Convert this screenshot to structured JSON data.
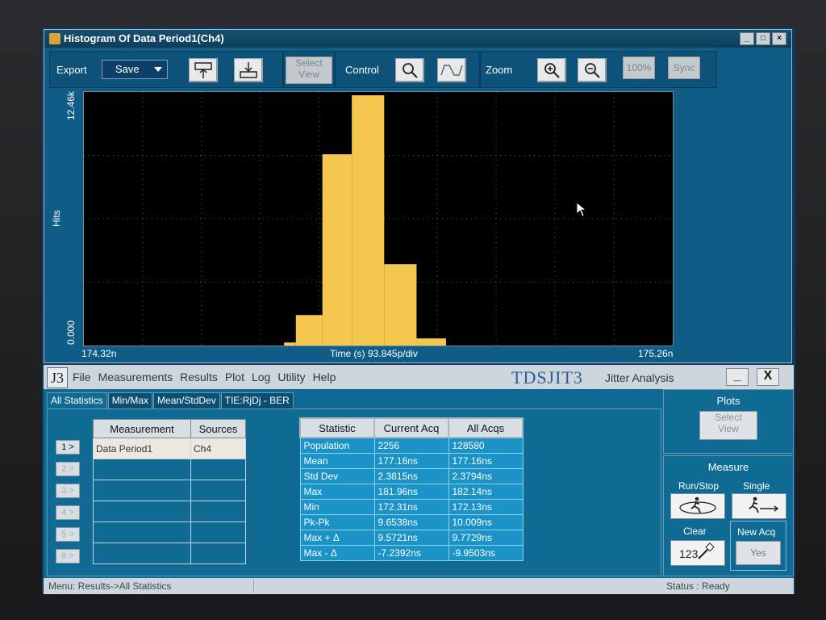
{
  "histogram_window": {
    "title": "Histogram Of Data Period1(Ch4)",
    "toolbar": {
      "export_label": "Export",
      "save_label": "Save",
      "select_view_label_1": "Select",
      "select_view_label_2": "View",
      "control_label": "Control",
      "zoom_label": "Zoom",
      "zoom_100_label": "100%",
      "sync_label": "Sync"
    },
    "plot": {
      "y_top": "12.46k",
      "y_bottom": "0.000",
      "y_label": "Hits",
      "x_left": "174.32n",
      "x_center": "Time (s)  93.845p/div",
      "x_right": "175.26n"
    }
  },
  "chart_data": {
    "type": "bar",
    "bar_color": "#f4c84f",
    "grid": true,
    "bins": [
      {
        "from": 3.4,
        "to": 3.6,
        "hits": 150
      },
      {
        "from": 3.6,
        "to": 4.05,
        "hits": 1500
      },
      {
        "from": 4.05,
        "to": 4.55,
        "hits": 9400
      },
      {
        "from": 4.55,
        "to": 5.1,
        "hits": 12300
      },
      {
        "from": 5.1,
        "to": 5.65,
        "hits": 4000
      },
      {
        "from": 5.65,
        "to": 6.15,
        "hits": 350
      }
    ],
    "x_divisions": 10,
    "y_divisions": 4,
    "ylim": [
      0,
      12460
    ]
  },
  "jitter_window": {
    "logo": "J3",
    "menu": [
      "File",
      "Measurements",
      "Results",
      "Plot",
      "Log",
      "Utility",
      "Help"
    ],
    "brand": "TDSJIT3",
    "brand_sub": "Jitter Analysis",
    "minimize": "_",
    "close": "X",
    "tabs": [
      "All Statistics",
      "Min/Max",
      "Mean/StdDev",
      "TIE:RjDj - BER"
    ],
    "measurement_table": {
      "headers": [
        "Measurement",
        "Sources"
      ],
      "rows": [
        {
          "button": "1 >",
          "measurement": "Data Period1",
          "source": "Ch4"
        },
        {
          "button": "2 >",
          "measurement": "",
          "source": ""
        },
        {
          "button": "3 >",
          "measurement": "",
          "source": ""
        },
        {
          "button": "4 >",
          "measurement": "",
          "source": ""
        },
        {
          "button": "5 >",
          "measurement": "",
          "source": ""
        },
        {
          "button": "6 >",
          "measurement": "",
          "source": ""
        }
      ]
    },
    "stats_table": {
      "headers": [
        "Statistic",
        "Current Acq",
        "All Acqs"
      ],
      "rows": [
        [
          "Population",
          "2256",
          "128580"
        ],
        [
          "Mean",
          "177.16ns",
          "177.16ns"
        ],
        [
          "Std Dev",
          "2.3815ns",
          "2.3794ns"
        ],
        [
          "Max",
          "181.96ns",
          "182.14ns"
        ],
        [
          "Min",
          "172.31ns",
          "172.13ns"
        ],
        [
          "Pk-Pk",
          "9.6538ns",
          "10.009ns"
        ],
        [
          "Max + Δ",
          "9.5721ns",
          "9.7729ns"
        ],
        [
          "Max - Δ",
          "-7.2392ns",
          "-9.9503ns"
        ]
      ]
    },
    "right_panel": {
      "plots_title": "Plots",
      "select_view_1": "Select",
      "select_view_2": "View",
      "measure_title": "Measure",
      "run_stop_label": "Run/Stop",
      "single_label": "Single",
      "clear_label": "Clear",
      "new_acq_label": "New Acq",
      "yes_label": "Yes"
    },
    "status": {
      "menu_path": "Menu: Results->All Statistics",
      "status_text": "Status : Ready"
    }
  }
}
